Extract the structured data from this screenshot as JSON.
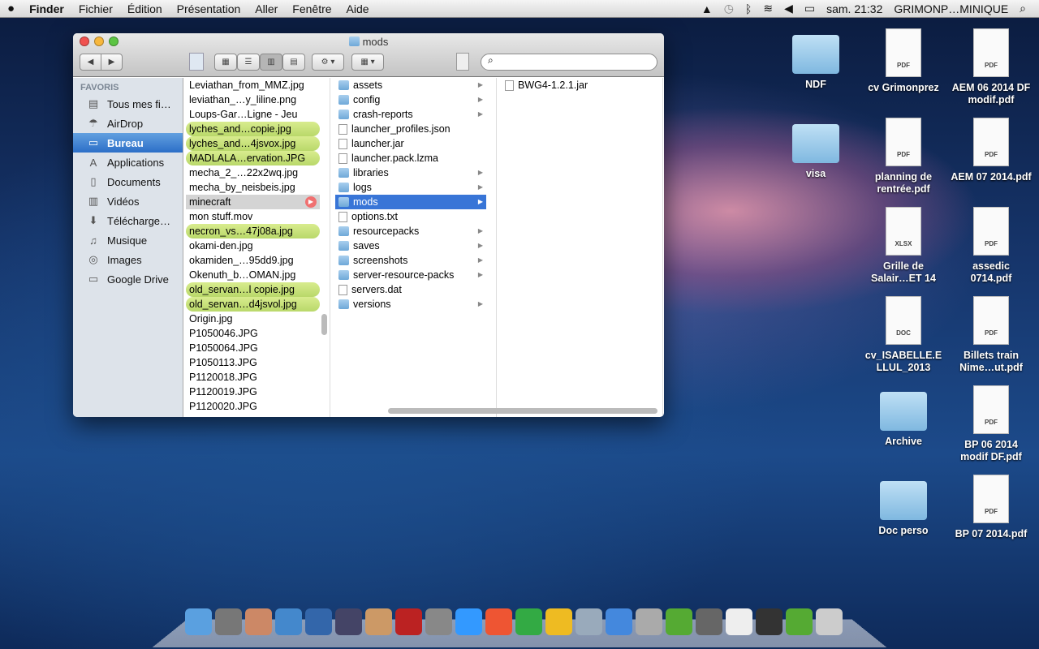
{
  "menubar": {
    "apple": "",
    "app": "Finder",
    "items": [
      "Fichier",
      "Édition",
      "Présentation",
      "Aller",
      "Fenêtre",
      "Aide"
    ],
    "clock": "sam. 21:32",
    "user": "GRIMONP…MINIQUE"
  },
  "window": {
    "title": "mods",
    "search_placeholder": "",
    "sidebar": {
      "header": "FAVORIS",
      "items": [
        {
          "label": "Tous mes fi…",
          "icon": "all-files-icon"
        },
        {
          "label": "AirDrop",
          "icon": "airdrop-icon"
        },
        {
          "label": "Bureau",
          "icon": "desktop-icon",
          "selected": true
        },
        {
          "label": "Applications",
          "icon": "applications-icon"
        },
        {
          "label": "Documents",
          "icon": "documents-icon"
        },
        {
          "label": "Vidéos",
          "icon": "movies-icon"
        },
        {
          "label": "Télécharge…",
          "icon": "downloads-icon"
        },
        {
          "label": "Musique",
          "icon": "music-icon"
        },
        {
          "label": "Images",
          "icon": "pictures-icon"
        },
        {
          "label": "Google Drive",
          "icon": "folder-icon"
        }
      ]
    },
    "column1": [
      {
        "n": "Leviathan_from_MMZ.jpg"
      },
      {
        "n": "leviathan_…y_liline.png"
      },
      {
        "n": "Loups-Gar…Ligne - Jeu"
      },
      {
        "n": "lyches_and…copie.jpg",
        "tag": "green"
      },
      {
        "n": "lyches_and…4jsvox.jpg",
        "tag": "green"
      },
      {
        "n": "MADLALA…ervation.JPG",
        "tag": "green"
      },
      {
        "n": "mecha_2_…22x2wq.jpg"
      },
      {
        "n": "mecha_by_neisbeis.jpg"
      },
      {
        "n": "minecraft",
        "tag": "gray",
        "folder": true
      },
      {
        "n": "mon stuff.mov"
      },
      {
        "n": "necron_vs…47j08a.jpg",
        "tag": "green"
      },
      {
        "n": "okami-den.jpg"
      },
      {
        "n": "okamiden_…95dd9.jpg"
      },
      {
        "n": "Okenuth_b…OMAN.jpg"
      },
      {
        "n": "old_servan…l copie.jpg",
        "tag": "green"
      },
      {
        "n": "old_servan…d4jsvol.jpg",
        "tag": "green"
      },
      {
        "n": "Origin.jpg"
      },
      {
        "n": "P1050046.JPG"
      },
      {
        "n": "P1050064.JPG"
      },
      {
        "n": "P1050113.JPG"
      },
      {
        "n": "P1120018.JPG"
      },
      {
        "n": "P1120019.JPG"
      },
      {
        "n": "P1120020.JPG"
      }
    ],
    "column2": [
      {
        "n": "assets",
        "folder": true
      },
      {
        "n": "config",
        "folder": true
      },
      {
        "n": "crash-reports",
        "folder": true
      },
      {
        "n": "launcher_profiles.json"
      },
      {
        "n": "launcher.jar"
      },
      {
        "n": "launcher.pack.lzma"
      },
      {
        "n": "libraries",
        "folder": true
      },
      {
        "n": "logs",
        "folder": true
      },
      {
        "n": "mods",
        "folder": true,
        "tag": "blue"
      },
      {
        "n": "options.txt"
      },
      {
        "n": "resourcepacks",
        "folder": true
      },
      {
        "n": "saves",
        "folder": true
      },
      {
        "n": "screenshots",
        "folder": true
      },
      {
        "n": "server-resource-packs",
        "folder": true
      },
      {
        "n": "servers.dat"
      },
      {
        "n": "versions",
        "folder": true
      }
    ],
    "column3": [
      {
        "n": "BWG4-1.2.1.jar"
      }
    ]
  },
  "desktop": [
    {
      "label": "NDF",
      "type": "folder"
    },
    {
      "label": "visa",
      "type": "folder"
    },
    {
      "label": "cv Grimonprez",
      "type": "PDF"
    },
    {
      "label": "planning de rentrée.pdf",
      "type": "PDF"
    },
    {
      "label": "Grille de Salair…ET 14",
      "type": "XLSX"
    },
    {
      "label": "cv_ISABELLE.E LLUL_2013",
      "type": "DOC"
    },
    {
      "label": "Archive",
      "type": "folder"
    },
    {
      "label": "Doc perso",
      "type": "folder"
    },
    {
      "label": "AEM 06 2014 DF modif.pdf",
      "type": "PDF"
    },
    {
      "label": "AEM 07 2014.pdf",
      "type": "PDF"
    },
    {
      "label": "assedic 0714.pdf",
      "type": "PDF"
    },
    {
      "label": "Billets train Nime…ut.pdf",
      "type": "PDF"
    },
    {
      "label": "BP 06 2014 modif DF.pdf",
      "type": "PDF"
    },
    {
      "label": "BP 07 2014.pdf",
      "type": "PDF"
    }
  ],
  "dock": {
    "colors": [
      "#5aa0e0",
      "#777",
      "#c86",
      "#48c",
      "#36a",
      "#446",
      "#c96",
      "#b22",
      "#888",
      "#39f",
      "#e53",
      "#3a4",
      "#eb2",
      "#9ab",
      "#48d",
      "#aaa",
      "#5a3",
      "#666",
      "#eee",
      "#333",
      "#5a3",
      "#ccc"
    ]
  }
}
